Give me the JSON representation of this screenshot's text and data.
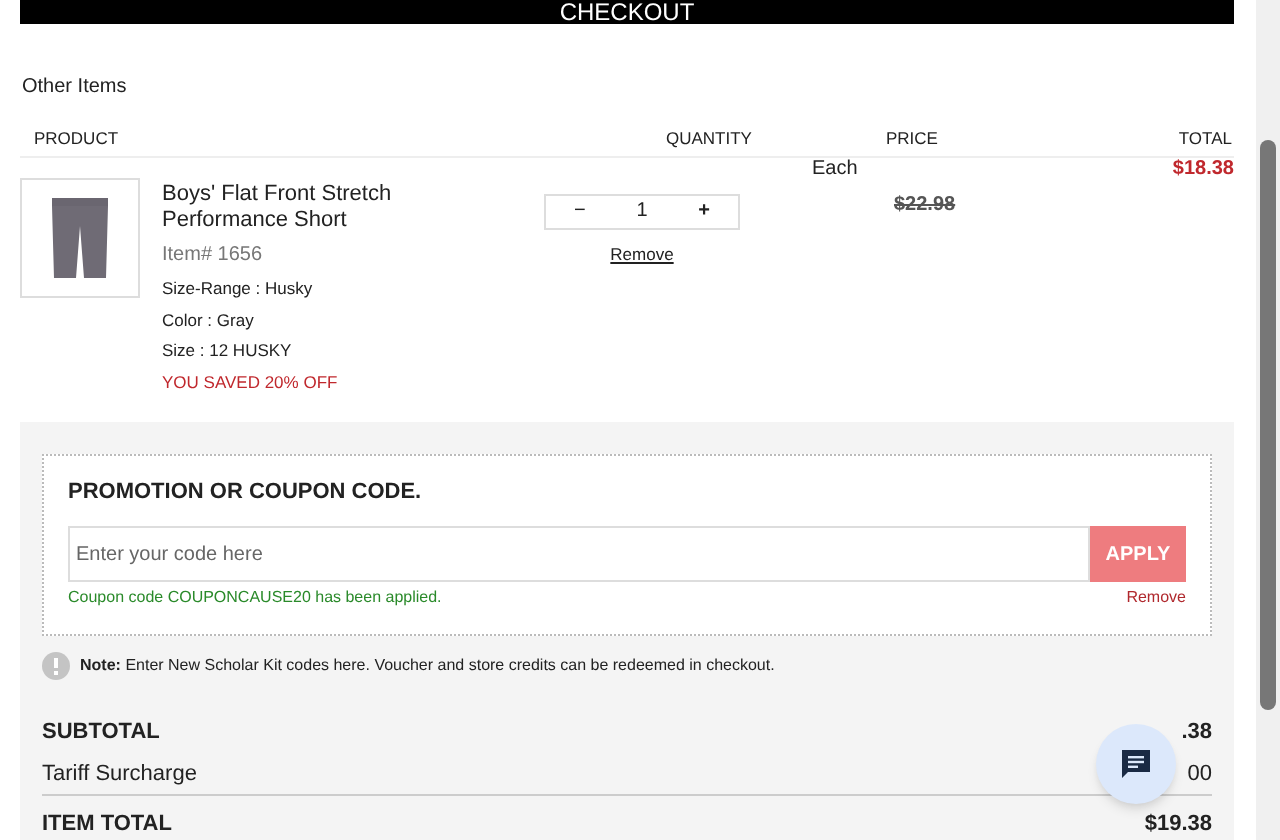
{
  "checkout_button": "CHECKOUT",
  "section_title": "Other Items",
  "table": {
    "columns": [
      "PRODUCT",
      "QUANTITY",
      "PRICE",
      "TOTAL"
    ],
    "rows": [
      {
        "kind": "picture",
        "name": "Boys' Flat Front Stretch Performance Short",
        "item_number": "Item# 1656",
        "attributes": [
          "Size-Range : Husky",
          "Color : Gray",
          "Size : 12 HUSKY"
        ],
        "savings": "YOU SAVED 20% OFF",
        "decrement": "−",
        "quantity": "1",
        "increment": "+",
        "remove": "Remove",
        "price_label": "Each",
        "original_price": "$22.98",
        "total": "$18.38"
      }
    ]
  },
  "coupon": {
    "title": "PROMOTION OR COUPON CODE.",
    "placeholder": "Enter your code here",
    "apply_button": "APPLY",
    "applied_message": "Coupon code COUPONCAUSE20 has been applied.",
    "remove": "Remove"
  },
  "note": {
    "label": "Note:",
    "text": "Enter New Scholar Kit codes here. Voucher and store credits can be redeemed in checkout."
  },
  "summary": [
    {
      "label": "SUBTOTAL",
      "value": ".38",
      "bold": true
    },
    {
      "label": "Tariff Surcharge",
      "value": "00",
      "bold": false
    },
    {
      "label": "ITEM TOTAL",
      "value": "$19.38",
      "bold": true
    }
  ]
}
